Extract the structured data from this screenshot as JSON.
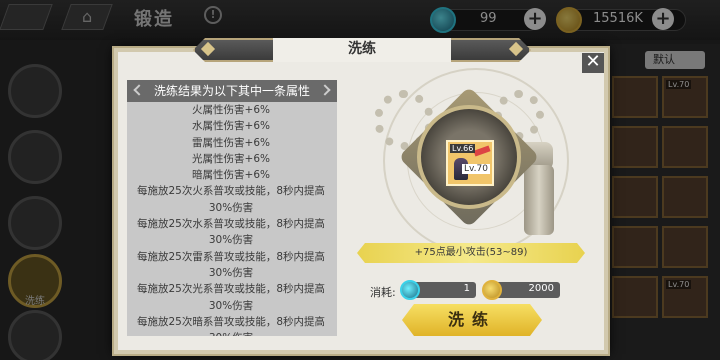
{
  "topbar": {
    "screen_title": "锻造",
    "info_glyph": "!",
    "home_glyph": "⌂",
    "gem_value": "99",
    "gold_value": "15516K",
    "plus_glyph": "+"
  },
  "sidebar": {
    "active_label": "洗练"
  },
  "right_list": {
    "sort_label": "默认",
    "card_level": "Lv.70"
  },
  "dialog": {
    "title": "洗练",
    "close_glyph": "✕",
    "result_heading": "洗练结果为以下其中一条属性",
    "attributes": [
      "火属性伤害+6%",
      "水属性伤害+6%",
      "雷属性伤害+6%",
      "光属性伤害+6%",
      "暗属性伤害+6%",
      "每施放25次火系普攻或技能，8秒内提高30%伤害",
      "每施放25次水系普攻或技能，8秒内提高30%伤害",
      "每施放25次雷系普攻或技能，8秒内提高30%伤害",
      "每施放25次光系普攻或技能，8秒内提高30%伤害",
      "每施放25次暗系普攻或技能，8秒内提高30%伤害"
    ],
    "item": {
      "level_top": "Lv.66",
      "level_main": "Lv.70"
    },
    "stat_line": "+75点最小攻击(53~89)",
    "cost_label": "消耗:",
    "cost_gem": "1",
    "cost_gold": "2000",
    "forge_button": "洗练"
  },
  "colors": {
    "accent_gold": "#e8c43a",
    "panel_gray": "#c8c8c8",
    "header_dark": "#3b3b3b"
  }
}
